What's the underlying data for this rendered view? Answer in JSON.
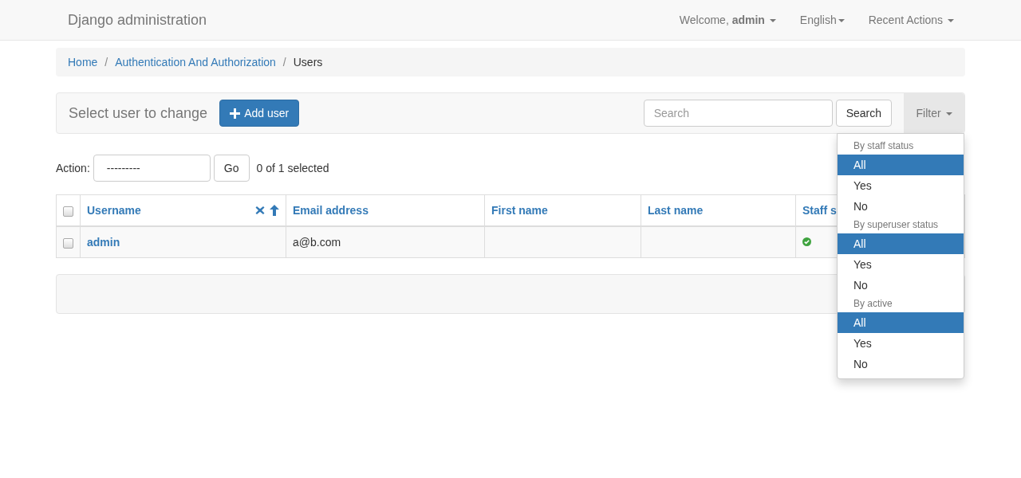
{
  "navbar": {
    "brand": "Django administration",
    "welcome": "Welcome,",
    "user": "admin",
    "language": "English",
    "recent": "Recent Actions"
  },
  "breadcrumbs": [
    {
      "label": "Home",
      "link": true
    },
    {
      "label": "Authentication And Authorization",
      "link": true,
      "separator": "/"
    },
    {
      "label": "Users",
      "link": false,
      "separator": "/"
    }
  ],
  "toolbar": {
    "title": "Select user to change",
    "add_button": "Add user",
    "search": {
      "placeholder": "Search"
    },
    "search_button": "Search",
    "filter_button": "Filter",
    "filter_open": true
  },
  "filter_menu": [
    {
      "title": "By staff status",
      "options": [
        {
          "label": "All",
          "selected": true
        },
        {
          "label": "Yes",
          "selected": false
        },
        {
          "label": "No",
          "selected": false
        }
      ]
    },
    {
      "title": "By superuser status",
      "options": [
        {
          "label": "All",
          "selected": true
        },
        {
          "label": "Yes",
          "selected": false
        },
        {
          "label": "No",
          "selected": false
        }
      ]
    },
    {
      "title": "By active",
      "options": [
        {
          "label": "All",
          "selected": true
        },
        {
          "label": "Yes",
          "selected": false
        },
        {
          "label": "No",
          "selected": false
        }
      ]
    }
  ],
  "actions": {
    "label": "Action:",
    "select_value": "---------",
    "go": "Go",
    "counter": "0 of 1 selected"
  },
  "table": {
    "select_all_checked": false,
    "columns": [
      {
        "label": "Username",
        "sorted": true
      },
      {
        "label": "Email address",
        "sorted": false
      },
      {
        "label": "First name",
        "sorted": false
      },
      {
        "label": "Last name",
        "sorted": false
      },
      {
        "label": "Staff s",
        "sorted": false
      }
    ],
    "rows": [
      {
        "checked": false,
        "username": "admin",
        "email": "a@b.com",
        "first_name": "",
        "last_name": "",
        "staff": true
      }
    ]
  }
}
